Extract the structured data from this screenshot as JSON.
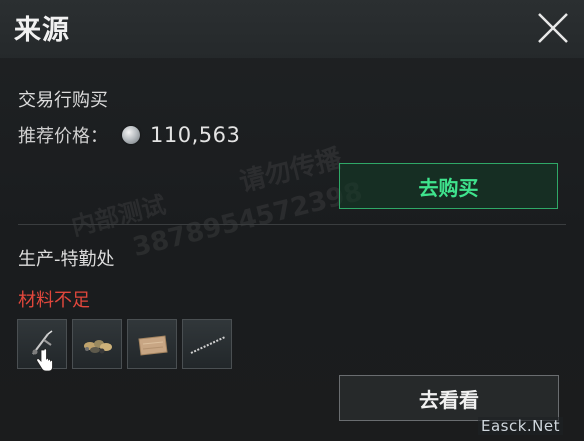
{
  "header": {
    "title": "来源",
    "close_icon": "close-icon"
  },
  "market": {
    "title": "交易行购买",
    "price_label": "推荐价格：",
    "currency_icon": "silver-coin-icon",
    "price_value": "110,563",
    "buy_button": "去购买",
    "accent_color": "#3fe38d"
  },
  "production": {
    "title": "生产-特勤处",
    "status": "材料不足",
    "status_color": "#e0473c",
    "materials": [
      {
        "icon": "tool-item-icon"
      },
      {
        "icon": "parts-pile-icon"
      },
      {
        "icon": "fabric-item-icon"
      },
      {
        "icon": "wire-item-icon"
      }
    ],
    "view_button": "去看看"
  },
  "watermarks": {
    "line1": "请勿传播",
    "line2": "内部测试",
    "line3": "3878954572398"
  },
  "site": "Easck.Net"
}
